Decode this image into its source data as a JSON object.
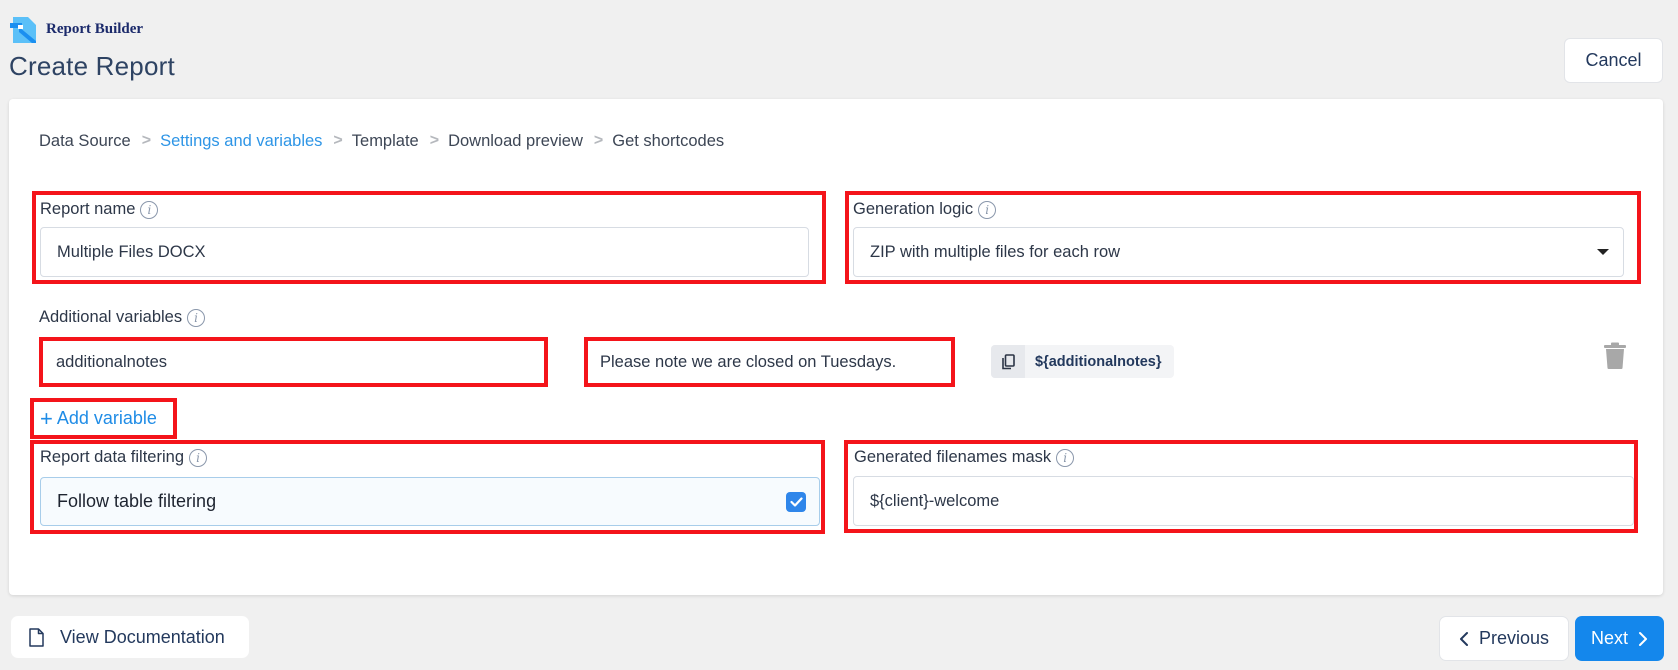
{
  "header": {
    "brand": "Report Builder",
    "page_title": "Create Report",
    "cancel_label": "Cancel"
  },
  "breadcrumb": {
    "steps": [
      "Data Source",
      "Settings and variables",
      "Template",
      "Download preview",
      "Get shortcodes"
    ],
    "active_index": 1,
    "separator": ">"
  },
  "form": {
    "report_name": {
      "label": "Report name",
      "value": "Multiple Files DOCX"
    },
    "generation_logic": {
      "label": "Generation logic",
      "selected": "ZIP with multiple files for each row"
    },
    "additional_variables": {
      "label": "Additional variables",
      "items": [
        {
          "name": "additionalnotes",
          "value": "Please note we are closed on Tuesdays.",
          "shortcode": "${additionalnotes}"
        }
      ],
      "add_label": "Add variable",
      "add_icon": "+"
    },
    "data_filtering": {
      "label": "Report data filtering",
      "option_label": "Follow table filtering",
      "checked": true
    },
    "filenames_mask": {
      "label": "Generated filenames mask",
      "value": "${client}-welcome"
    },
    "info_icon": "i"
  },
  "footer": {
    "docs_label": "View Documentation",
    "previous_label": "Previous",
    "next_label": "Next"
  },
  "colors": {
    "accent": "#1487ec",
    "active_step": "#2e95e6",
    "highlight_box": "#f4141a",
    "checkbox": "#2f86ea"
  }
}
